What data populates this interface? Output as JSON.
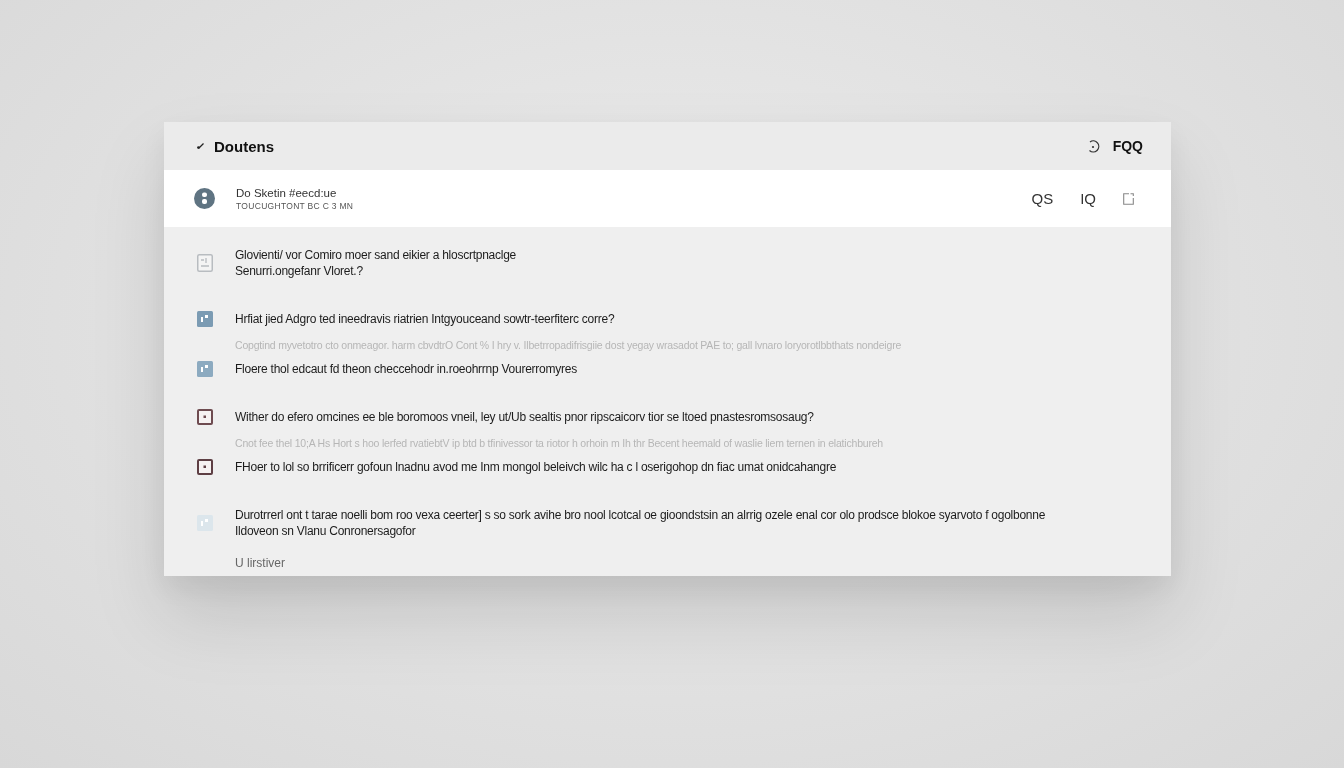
{
  "header": {
    "title": "Doutens",
    "link": "FQQ"
  },
  "profile": {
    "name": "Do Sketin #eecd:ue",
    "subtitle": "TOUCUGHTONT BC C 3 MN",
    "actions": [
      "QS",
      "IQ"
    ]
  },
  "faq": {
    "items": [
      {
        "kind": "doc",
        "color": "#b8bcc0",
        "lines": [
          "Glovienti/ vor Comiro moer sand eikier a hloscrtpnaclge",
          "Senurri.ongefanr Vloret.?"
        ]
      },
      {
        "kind": "tile",
        "color": "#7b9bb3",
        "lines": [
          "Hrfiat jied  Adgro ted ineedravis riatrien Intgyouceand sowtr-teerfiterc corre?"
        ],
        "answer": "Copgtind myvetotro cto onmeagor. harm cbvdtrO Cont % I hry v. Ilbetrropadifrisgiie dost yegay wrasadot PAE to; gall lvnaro loryorotlbbthats  nondeigre"
      },
      {
        "kind": "tile",
        "color": "#8caac0",
        "lines": [
          "Floere thol edcaut fd theon checcehodr in.roeohrrnp Vourerromyres"
        ]
      },
      {
        "kind": "frame",
        "color": "#6e4b50",
        "lines": [
          "Wither do efero omcines ee ble boromoos vneil, ley ut/Ub sealtis pnor ripscaicorv tior se ltoed pnastesromsosaug?"
        ],
        "answer": "Cnot fee thel 10;A Hs Hort s hoo lerfed rvatiebtV ip btd b tfinivessor ta riotor h orhoin m Ih thr Becent heemald of waslie liem ternen in elatichbureh"
      },
      {
        "kind": "frame",
        "color": "#5e3f44",
        "lines": [
          "FHoer to lol so brrificerr gofoun lnadnu avod me Inm mongol beleivch wilc ha c l oserigohop dn fiac umat onidcahangre"
        ]
      },
      {
        "kind": "tile",
        "color": "#dce6ec",
        "lines": [
          "Durotrrerl ont t tarae noelli bom roo vexa ceerter] s so sork avihe bro nool lcotcal oe gioondstsin an alrrig ozele enal cor olo prodsce blokoe syarvoto f ogolbonne",
          "Ildoveon sn Vlanu Conronersagofor"
        ]
      }
    ],
    "more": "U lirstiver"
  }
}
